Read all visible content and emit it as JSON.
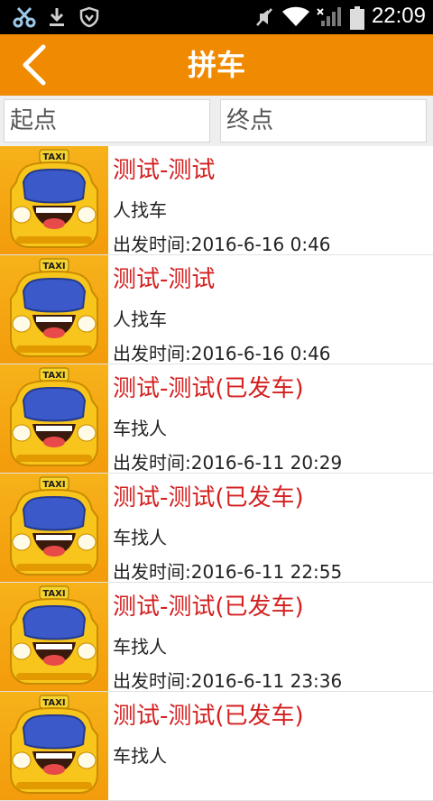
{
  "status_bar": {
    "time": "22:09",
    "icons": [
      "scissors-icon",
      "download-icon",
      "shield-icon",
      "mute-icon",
      "wifi-icon",
      "signal-icon",
      "battery-icon"
    ]
  },
  "app_bar": {
    "title": "拼车",
    "back_icon": "chevron-left-icon",
    "color": "#f08a00"
  },
  "search": {
    "start_placeholder": "起点",
    "end_placeholder": "终点"
  },
  "list": {
    "title_color": "#d42020",
    "items": [
      {
        "title": "测试-测试",
        "type": "人找车",
        "time": "出发时间:2016-6-16 0:46"
      },
      {
        "title": "测试-测试",
        "type": "人找车",
        "time": "出发时间:2016-6-16 0:46"
      },
      {
        "title": "测试-测试(已发车)",
        "type": "车找人",
        "time": "出发时间:2016-6-11 20:29"
      },
      {
        "title": "测试-测试(已发车)",
        "type": "车找人",
        "time": "出发时间:2016-6-11 22:55"
      },
      {
        "title": "测试-测试(已发车)",
        "type": "车找人",
        "time": "出发时间:2016-6-11 23:36"
      },
      {
        "title": "测试-测试(已发车)",
        "type": "车找人",
        "time": ""
      }
    ],
    "thumb_sign": "TAXI"
  }
}
